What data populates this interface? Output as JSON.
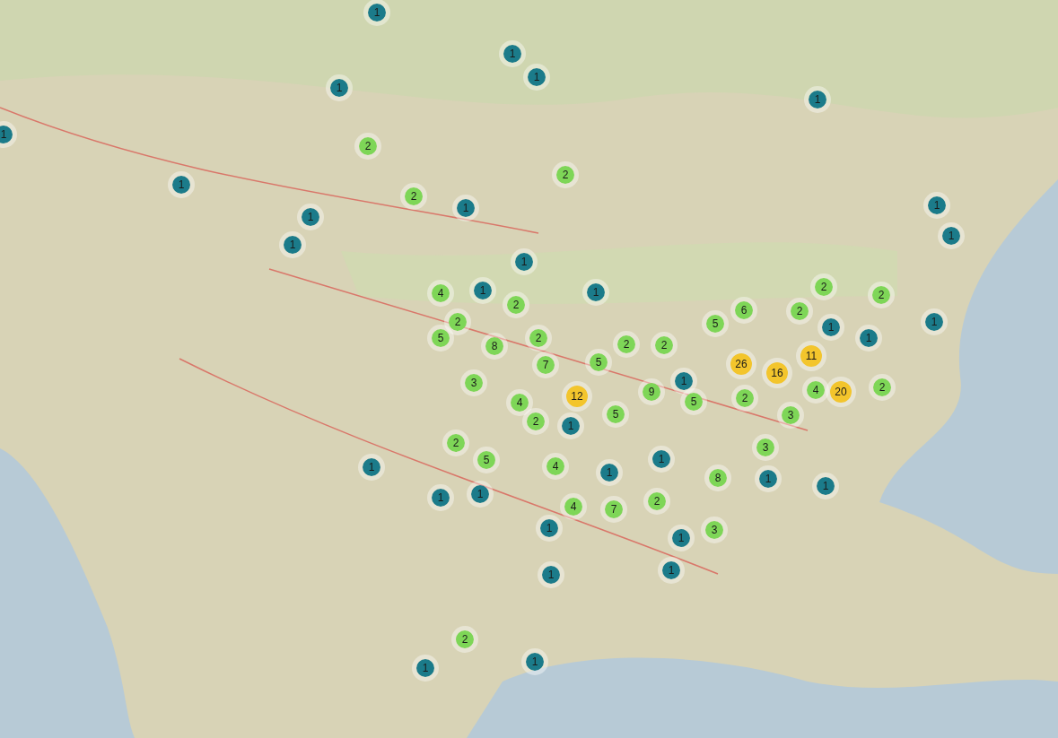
{
  "clusters": [
    {
      "count": "1",
      "color": "#1b7b8a"
    },
    {
      "count": "1",
      "color": "#1b7b8a"
    },
    {
      "count": "1",
      "color": "#1b7b8a"
    },
    {
      "count": "1",
      "color": "#1b7b8a"
    },
    {
      "count": "1",
      "color": "#1b7b8a"
    },
    {
      "count": "1",
      "color": "#1b7b8a"
    },
    {
      "count": "1",
      "color": "#1b7b8a"
    },
    {
      "count": "1",
      "color": "#1b7b8a"
    },
    {
      "count": "1",
      "color": "#1b7b8a"
    },
    {
      "count": "1",
      "color": "#1b7b8a"
    },
    {
      "count": "1",
      "color": "#1b7b8a"
    },
    {
      "count": "1",
      "color": "#1b7b8a"
    },
    {
      "count": "1",
      "color": "#1b7b8a"
    },
    {
      "count": "1",
      "color": "#1b7b8a"
    },
    {
      "count": "1",
      "color": "#1b7b8a"
    },
    {
      "count": "1",
      "color": "#1b7b8a"
    },
    {
      "count": "1",
      "color": "#1b7b8a"
    },
    {
      "count": "1",
      "color": "#1b7b8a"
    },
    {
      "count": "1",
      "color": "#1b7b8a"
    },
    {
      "count": "1",
      "color": "#1b7b8a"
    },
    {
      "count": "1",
      "color": "#1b7b8a"
    },
    {
      "count": "1",
      "color": "#1b7b8a"
    },
    {
      "count": "1",
      "color": "#1b7b8a"
    },
    {
      "count": "1",
      "color": "#1b7b8a"
    },
    {
      "count": "1",
      "color": "#1b7b8a"
    },
    {
      "count": "1",
      "color": "#1b7b8a"
    },
    {
      "count": "1",
      "color": "#1b7b8a"
    },
    {
      "count": "1",
      "color": "#1b7b8a"
    },
    {
      "count": "1",
      "color": "#1b7b8a"
    },
    {
      "count": "1",
      "color": "#1b7b8a"
    },
    {
      "count": "1",
      "color": "#1b7b8a"
    },
    {
      "count": "1",
      "color": "#1b7b8a"
    },
    {
      "count": "1",
      "color": "#1b7b8a"
    },
    {
      "count": "2",
      "color": "#7ed657"
    },
    {
      "count": "2",
      "color": "#7ed657"
    },
    {
      "count": "2",
      "color": "#7ed657"
    },
    {
      "count": "4",
      "color": "#7ed657"
    },
    {
      "count": "2",
      "color": "#7ed657"
    },
    {
      "count": "2",
      "color": "#7ed657"
    },
    {
      "count": "5",
      "color": "#7ed657"
    },
    {
      "count": "8",
      "color": "#7ed657"
    },
    {
      "count": "2",
      "color": "#7ed657"
    },
    {
      "count": "7",
      "color": "#7ed657"
    },
    {
      "count": "5",
      "color": "#7ed657"
    },
    {
      "count": "2",
      "color": "#7ed657"
    },
    {
      "count": "2",
      "color": "#7ed657"
    },
    {
      "count": "5",
      "color": "#7ed657"
    },
    {
      "count": "6",
      "color": "#7ed657"
    },
    {
      "count": "2",
      "color": "#7ed657"
    },
    {
      "count": "2",
      "color": "#7ed657"
    },
    {
      "count": "2",
      "color": "#7ed657"
    },
    {
      "count": "3",
      "color": "#7ed657"
    },
    {
      "count": "4",
      "color": "#7ed657"
    },
    {
      "count": "2",
      "color": "#7ed657"
    },
    {
      "count": "5",
      "color": "#7ed657"
    },
    {
      "count": "9",
      "color": "#7ed657"
    },
    {
      "count": "5",
      "color": "#7ed657"
    },
    {
      "count": "2",
      "color": "#7ed657"
    },
    {
      "count": "4",
      "color": "#7ed657"
    },
    {
      "count": "3",
      "color": "#7ed657"
    },
    {
      "count": "2",
      "color": "#7ed657"
    },
    {
      "count": "3",
      "color": "#7ed657"
    },
    {
      "count": "2",
      "color": "#7ed657"
    },
    {
      "count": "5",
      "color": "#7ed657"
    },
    {
      "count": "4",
      "color": "#7ed657"
    },
    {
      "count": "4",
      "color": "#7ed657"
    },
    {
      "count": "7",
      "color": "#7ed657"
    },
    {
      "count": "2",
      "color": "#7ed657"
    },
    {
      "count": "8",
      "color": "#7ed657"
    },
    {
      "count": "3",
      "color": "#7ed657"
    },
    {
      "count": "2",
      "color": "#7ed657"
    },
    {
      "count": "12",
      "color": "#f3c52c"
    },
    {
      "count": "26",
      "color": "#f3c52c"
    },
    {
      "count": "16",
      "color": "#f3c52c"
    },
    {
      "count": "11",
      "color": "#f3c52c"
    },
    {
      "count": "20",
      "color": "#f3c52c"
    }
  ]
}
